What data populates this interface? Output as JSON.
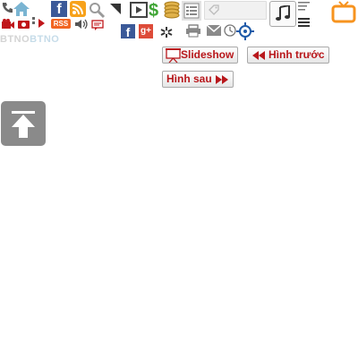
{
  "brand": {
    "part1": "BTNO",
    "part2": "BTNO"
  },
  "toolbar": {
    "rss_label": "RSS",
    "facebook_letter": "f",
    "googleplus_letter": "g+"
  },
  "buttons": {
    "slideshow": "Slideshow",
    "previous": "Hình trước",
    "next": "Hình sau"
  },
  "colors": {
    "button_text": "#b8171b",
    "facebook": "#3b5998",
    "googleplus": "#dd4b39",
    "rss": "#f26522",
    "tv_icon": "#f7931e"
  }
}
